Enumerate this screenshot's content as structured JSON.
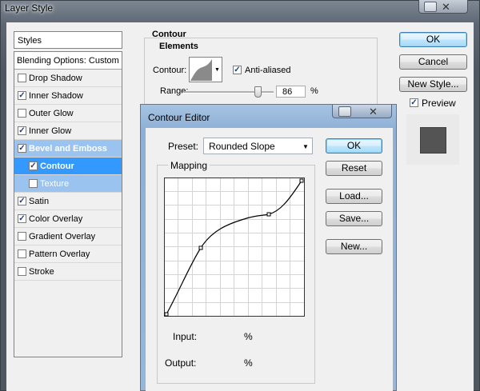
{
  "window": {
    "title": "Layer Style"
  },
  "styles_panel": {
    "header": "Styles",
    "blending_options": "Blending Options: Custom",
    "items": [
      {
        "label": "Drop Shadow",
        "checked": false
      },
      {
        "label": "Inner Shadow",
        "checked": true
      },
      {
        "label": "Outer Glow",
        "checked": false
      },
      {
        "label": "Inner Glow",
        "checked": true
      },
      {
        "label": "Bevel and Emboss",
        "checked": true
      },
      {
        "label": "Contour",
        "checked": true
      },
      {
        "label": "Texture",
        "checked": false
      },
      {
        "label": "Satin",
        "checked": true
      },
      {
        "label": "Color Overlay",
        "checked": true
      },
      {
        "label": "Gradient Overlay",
        "checked": false
      },
      {
        "label": "Pattern Overlay",
        "checked": false
      },
      {
        "label": "Stroke",
        "checked": false
      }
    ]
  },
  "contour_section": {
    "title": "Contour",
    "subtitle": "Elements",
    "contour_label": "Contour:",
    "anti_aliased_label": "Anti-aliased",
    "anti_aliased_checked": true,
    "range_label": "Range:",
    "range_value": "86",
    "range_unit": "%"
  },
  "dialog_buttons": {
    "ok": "OK",
    "cancel": "Cancel",
    "new_style": "New Style...",
    "preview_label": "Preview",
    "preview_checked": true
  },
  "contour_editor": {
    "title": "Contour Editor",
    "preset_label": "Preset:",
    "preset_value": "Rounded Slope",
    "mapping_label": "Mapping",
    "input_label": "Input:",
    "input_unit": "%",
    "output_label": "Output:",
    "output_unit": "%",
    "buttons": {
      "ok": "OK",
      "reset": "Reset",
      "load": "Load...",
      "save": "Save...",
      "new": "New..."
    }
  },
  "colors": {
    "selected": "#3399ff",
    "selected_light": "#9ac3f0",
    "preview_swatch": "#545454"
  }
}
